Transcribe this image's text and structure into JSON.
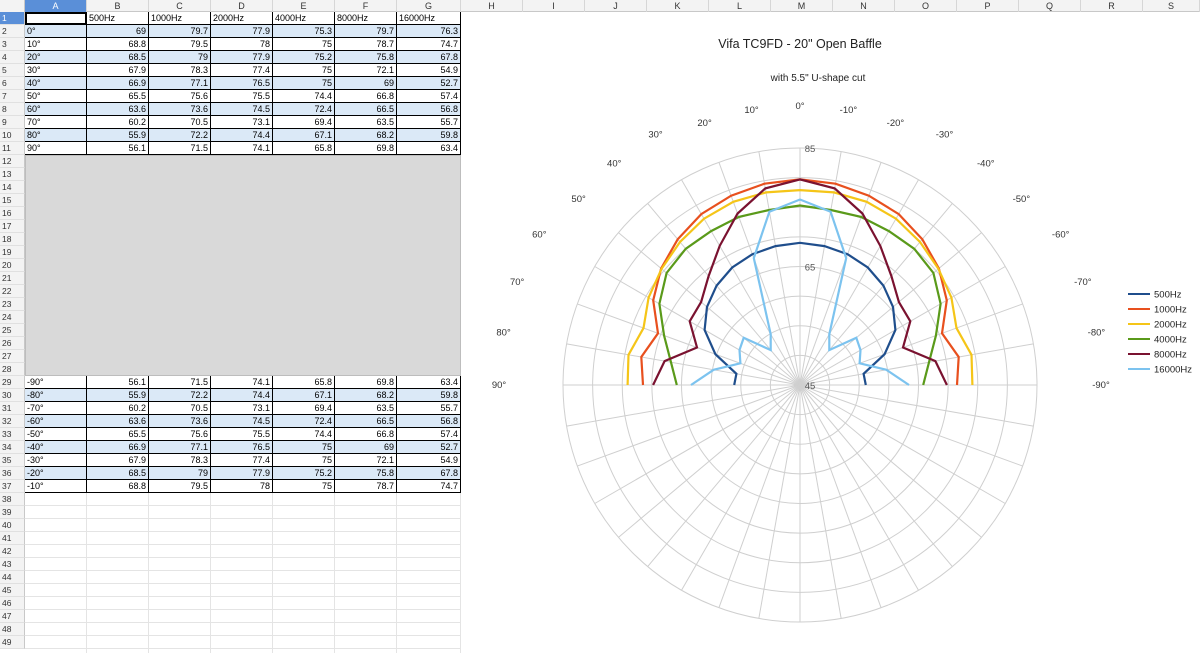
{
  "columns": [
    "A",
    "B",
    "C",
    "D",
    "E",
    "F",
    "G",
    "H",
    "I",
    "J",
    "K",
    "L",
    "M",
    "N",
    "O",
    "P",
    "Q",
    "R",
    "S"
  ],
  "header_row": [
    "",
    "500Hz",
    "1000Hz",
    "2000Hz",
    "4000Hz",
    "8000Hz",
    "16000Hz"
  ],
  "upper_rows": [
    {
      "row": 2,
      "angle": "0°",
      "values": [
        "69",
        "79.7",
        "77.9",
        "75.3",
        "79.7",
        "76.3"
      ]
    },
    {
      "row": 3,
      "angle": "10°",
      "values": [
        "68.8",
        "79.5",
        "78",
        "75",
        "78.7",
        "74.7"
      ]
    },
    {
      "row": 4,
      "angle": "20°",
      "values": [
        "68.5",
        "79",
        "77.9",
        "75.2",
        "75.8",
        "67.8"
      ]
    },
    {
      "row": 5,
      "angle": "30°",
      "values": [
        "67.9",
        "78.3",
        "77.4",
        "75",
        "72.1",
        "54.9"
      ]
    },
    {
      "row": 6,
      "angle": "40°",
      "values": [
        "66.9",
        "77.1",
        "76.5",
        "75",
        "69",
        "52.7"
      ]
    },
    {
      "row": 7,
      "angle": "50°",
      "values": [
        "65.5",
        "75.6",
        "75.5",
        "74.4",
        "66.8",
        "57.4"
      ]
    },
    {
      "row": 8,
      "angle": "60°",
      "values": [
        "63.6",
        "73.6",
        "74.5",
        "72.4",
        "66.5",
        "56.8"
      ]
    },
    {
      "row": 9,
      "angle": "70°",
      "values": [
        "60.2",
        "70.5",
        "73.1",
        "69.4",
        "63.5",
        "55.7"
      ]
    },
    {
      "row": 10,
      "angle": "80°",
      "values": [
        "55.9",
        "72.2",
        "74.4",
        "67.1",
        "68.2",
        "59.8"
      ]
    },
    {
      "row": 11,
      "angle": "90°",
      "values": [
        "56.1",
        "71.5",
        "74.1",
        "65.8",
        "69.8",
        "63.4"
      ]
    }
  ],
  "lower_rows": [
    {
      "row": 29,
      "angle": "-90°",
      "values": [
        "56.1",
        "71.5",
        "74.1",
        "65.8",
        "69.8",
        "63.4"
      ]
    },
    {
      "row": 30,
      "angle": "-80°",
      "values": [
        "55.9",
        "72.2",
        "74.4",
        "67.1",
        "68.2",
        "59.8"
      ]
    },
    {
      "row": 31,
      "angle": "-70°",
      "values": [
        "60.2",
        "70.5",
        "73.1",
        "69.4",
        "63.5",
        "55.7"
      ]
    },
    {
      "row": 32,
      "angle": "-60°",
      "values": [
        "63.6",
        "73.6",
        "74.5",
        "72.4",
        "66.5",
        "56.8"
      ]
    },
    {
      "row": 33,
      "angle": "-50°",
      "values": [
        "65.5",
        "75.6",
        "75.5",
        "74.4",
        "66.8",
        "57.4"
      ]
    },
    {
      "row": 34,
      "angle": "-40°",
      "values": [
        "66.9",
        "77.1",
        "76.5",
        "75",
        "69",
        "52.7"
      ]
    },
    {
      "row": 35,
      "angle": "-30°",
      "values": [
        "67.9",
        "78.3",
        "77.4",
        "75",
        "72.1",
        "54.9"
      ]
    },
    {
      "row": 36,
      "angle": "-20°",
      "values": [
        "68.5",
        "79",
        "77.9",
        "75.2",
        "75.8",
        "67.8"
      ]
    },
    {
      "row": 37,
      "angle": "-10°",
      "values": [
        "68.8",
        "79.5",
        "78",
        "75",
        "78.7",
        "74.7"
      ]
    }
  ],
  "chart_data": {
    "type": "polar-line",
    "title": "Vifa TC9FD - 20\" Open Baffle",
    "subtitle": "with 5.5\" U-shape cut",
    "angle_labels": [
      "0°",
      "10°",
      "20°",
      "30°",
      "40°",
      "50°",
      "60°",
      "70°",
      "80°",
      "90°",
      "-10°",
      "-20°",
      "-30°",
      "-40°",
      "-50°",
      "-60°",
      "-70°",
      "-80°",
      "-90°"
    ],
    "radial_ticks": [
      "85",
      "65",
      "45"
    ],
    "rlim": [
      45,
      85
    ],
    "angles": [
      90,
      80,
      70,
      60,
      50,
      40,
      30,
      20,
      10,
      0,
      -10,
      -20,
      -30,
      -40,
      -50,
      -60,
      -70,
      -80,
      -90
    ],
    "series": [
      {
        "name": "500Hz",
        "color": "#1f4e8c",
        "values": [
          56.1,
          55.9,
          60.2,
          63.6,
          65.5,
          66.9,
          67.9,
          68.5,
          68.8,
          69,
          68.8,
          68.5,
          67.9,
          66.9,
          65.5,
          63.6,
          60.2,
          55.9,
          56.1
        ]
      },
      {
        "name": "1000Hz",
        "color": "#e8501e",
        "values": [
          71.5,
          72.2,
          70.5,
          73.6,
          75.6,
          77.1,
          78.3,
          79,
          79.5,
          79.7,
          79.5,
          79,
          78.3,
          77.1,
          75.6,
          73.6,
          70.5,
          72.2,
          71.5
        ]
      },
      {
        "name": "2000Hz",
        "color": "#f5c518",
        "values": [
          74.1,
          74.4,
          73.1,
          74.5,
          75.5,
          76.5,
          77.4,
          77.9,
          78,
          77.9,
          78,
          77.9,
          77.4,
          76.5,
          75.5,
          74.5,
          73.1,
          74.4,
          74.1
        ]
      },
      {
        "name": "4000Hz",
        "color": "#5a9a1a",
        "values": [
          65.8,
          67.1,
          69.4,
          72.4,
          74.4,
          75,
          75,
          75.2,
          75,
          75.3,
          75,
          75.2,
          75,
          75,
          74.4,
          72.4,
          69.4,
          67.1,
          65.8
        ]
      },
      {
        "name": "8000Hz",
        "color": "#7a1230",
        "values": [
          69.8,
          68.2,
          63.5,
          66.5,
          66.8,
          69,
          72.1,
          75.8,
          78.7,
          79.7,
          78.7,
          75.8,
          72.1,
          69,
          66.8,
          66.5,
          63.5,
          68.2,
          69.8
        ]
      },
      {
        "name": "16000Hz",
        "color": "#7cc3ef",
        "values": [
          63.4,
          59.8,
          55.7,
          56.8,
          57.4,
          52.7,
          54.9,
          67.8,
          74.7,
          76.3,
          74.7,
          67.8,
          54.9,
          52.7,
          57.4,
          56.8,
          55.7,
          59.8,
          63.4
        ]
      }
    ],
    "legend": "right"
  }
}
